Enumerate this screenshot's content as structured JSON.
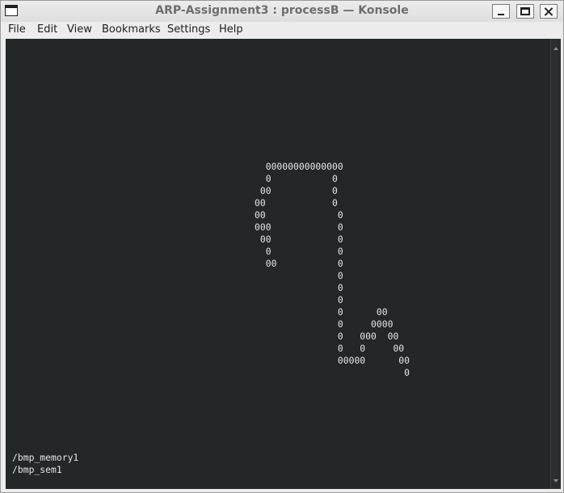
{
  "window": {
    "title": "ARP-Assignment3 : processB — Konsole",
    "icon": "window-icon"
  },
  "menu": [
    {
      "label": "File"
    },
    {
      "label": "Edit"
    },
    {
      "label": "View"
    },
    {
      "label": "Bookmarks"
    },
    {
      "label": "Settings"
    },
    {
      "label": "Help"
    }
  ],
  "terminal": {
    "art_lines": [
      "  00000000000000",
      "  0           0",
      " 00           0",
      "00            0",
      "00             0",
      "000            0",
      " 00            0",
      "  0            0",
      "  00           0",
      "               0",
      "               0",
      "               0",
      "               0      00",
      "               0     0000",
      "               0   000  00",
      "               0   0     00",
      "               00000      00",
      "                           0"
    ],
    "output_lines": [
      "/bmp_memory1",
      "/bmp_sem1"
    ]
  }
}
